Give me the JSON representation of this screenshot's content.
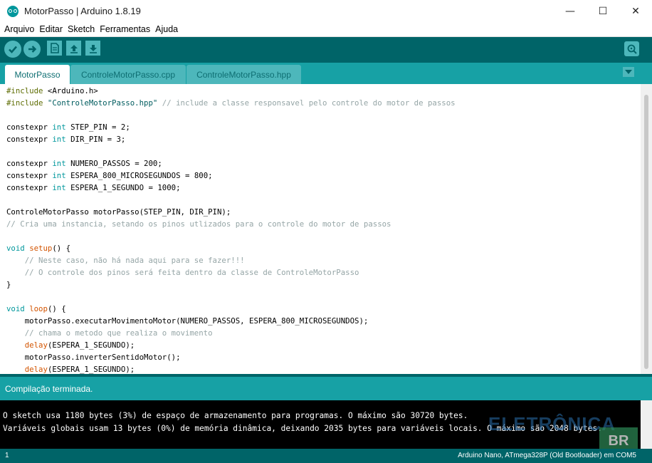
{
  "window": {
    "title": "MotorPasso | Arduino 1.8.19",
    "controls": {
      "minimize": "—",
      "maximize": "☐",
      "close": "✕"
    }
  },
  "menu": [
    "Arquivo",
    "Editar",
    "Sketch",
    "Ferramentas",
    "Ajuda"
  ],
  "toolbar": {
    "buttons": [
      "verify-icon",
      "upload-icon",
      "new-icon",
      "open-icon",
      "save-icon"
    ],
    "right": "serial-monitor-icon"
  },
  "tabs": [
    "MotorPasso",
    "ControleMotorPasso.cpp",
    "ControleMotorPasso.hpp"
  ],
  "code": {
    "l1_a": "#include ",
    "l1_b": "<Arduino.h>",
    "l2_a": "#include ",
    "l2_b": "\"ControleMotorPasso.hpp\"",
    "l2_c": " // include a classe responsavel pelo controle do motor de passos",
    "l4_a": "constexpr ",
    "l4_b": "int",
    "l4_c": " STEP_PIN = 2;",
    "l5_a": "constexpr ",
    "l5_b": "int",
    "l5_c": " DIR_PIN = 3;",
    "l7_a": "constexpr ",
    "l7_b": "int",
    "l7_c": " NUMERO_PASSOS = 200;",
    "l8_a": "constexpr ",
    "l8_b": "int",
    "l8_c": " ESPERA_800_MICROSEGUNDOS = 800;",
    "l9_a": "constexpr ",
    "l9_b": "int",
    "l9_c": " ESPERA_1_SEGUNDO = 1000;",
    "l11": "ControleMotorPasso motorPasso(STEP_PIN, DIR_PIN);",
    "l12": "// Cria uma instancia, setando os pinos utlizados para o controle do motor de passos",
    "l14_a": "void",
    "l14_b": " ",
    "l14_c": "setup",
    "l14_d": "() {",
    "l15": "    // Neste caso, não há nada aqui para se fazer!!!",
    "l16": "    // O controle dos pinos será feita dentro da classe de ControleMotorPasso",
    "l17": "}",
    "l19_a": "void",
    "l19_b": " ",
    "l19_c": "loop",
    "l19_d": "() {",
    "l20": "    motorPasso.executarMovimentoMotor(NUMERO_PASSOS, ESPERA_800_MICROSEGUNDOS);",
    "l21": "    // chama o metodo que realiza o movimento",
    "l22_a": "    ",
    "l22_b": "delay",
    "l22_c": "(ESPERA_1_SEGUNDO);",
    "l23": "    motorPasso.inverterSentidoMotor();",
    "l24_a": "    ",
    "l24_b": "delay",
    "l24_c": "(ESPERA_1_SEGUNDO);"
  },
  "status": "Compilação terminada.",
  "console": [
    "O sketch usa 1180 bytes (3%) de espaço de armazenamento para programas. O máximo são 30720 bytes.",
    "Variáveis globais usam 13 bytes (0%) de memória dinâmica, deixando 2035 bytes para variáveis locais. O máximo são 2048 bytes."
  ],
  "watermark": {
    "text": "ELETRÔNICA",
    "badge": "BR"
  },
  "footer": {
    "line": "1",
    "board": "Arduino Nano, ATmega328P (Old Bootloader) em COM5"
  },
  "colors": {
    "teal_dark": "#006468",
    "teal": "#17a1a5",
    "teal_light": "#4db7bb"
  }
}
